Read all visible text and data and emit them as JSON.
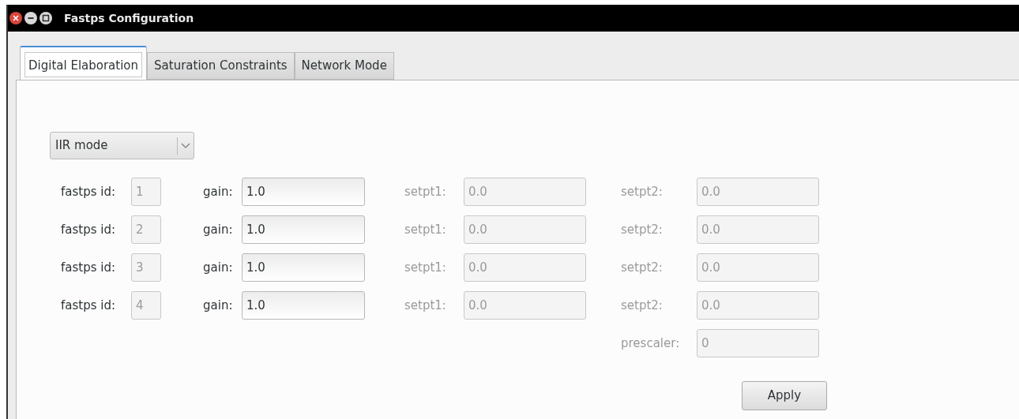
{
  "window": {
    "title": "Fastps Configuration"
  },
  "tabs": [
    {
      "label": "Digital Elaboration",
      "selected": true
    },
    {
      "label": "Saturation Constraints",
      "selected": false
    },
    {
      "label": "Network Mode",
      "selected": false
    }
  ],
  "mode_select": {
    "value": "IIR mode"
  },
  "rows": [
    {
      "id": {
        "label": "fastps id:",
        "label_disabled": false,
        "value": "1",
        "disabled": true
      },
      "gain": {
        "label": "gain:",
        "label_disabled": false,
        "value": "1.0",
        "disabled": false
      },
      "setpt1": {
        "label": "setpt1:",
        "label_disabled": true,
        "value": "0.0",
        "disabled": true
      },
      "setpt2": {
        "label": "setpt2:",
        "label_disabled": true,
        "value": "0.0",
        "disabled": true
      }
    },
    {
      "id": {
        "label": "fastps id:",
        "label_disabled": false,
        "value": "2",
        "disabled": true
      },
      "gain": {
        "label": "gain:",
        "label_disabled": false,
        "value": "1.0",
        "disabled": false
      },
      "setpt1": {
        "label": "setpt1:",
        "label_disabled": true,
        "value": "0.0",
        "disabled": true
      },
      "setpt2": {
        "label": "setpt2:",
        "label_disabled": true,
        "value": "0.0",
        "disabled": true
      }
    },
    {
      "id": {
        "label": "fastps id:",
        "label_disabled": false,
        "value": "3",
        "disabled": true
      },
      "gain": {
        "label": "gain:",
        "label_disabled": false,
        "value": "1.0",
        "disabled": false
      },
      "setpt1": {
        "label": "setpt1:",
        "label_disabled": true,
        "value": "0.0",
        "disabled": true
      },
      "setpt2": {
        "label": "setpt2:",
        "label_disabled": true,
        "value": "0.0",
        "disabled": true
      }
    },
    {
      "id": {
        "label": "fastps id:",
        "label_disabled": false,
        "value": "4",
        "disabled": true
      },
      "gain": {
        "label": "gain:",
        "label_disabled": false,
        "value": "1.0",
        "disabled": false
      },
      "setpt1": {
        "label": "setpt1:",
        "label_disabled": true,
        "value": "0.0",
        "disabled": true
      },
      "setpt2": {
        "label": "setpt2:",
        "label_disabled": true,
        "value": "0.0",
        "disabled": true
      }
    }
  ],
  "prescaler": {
    "label": "prescaler:",
    "label_disabled": true,
    "value": "0",
    "disabled": true
  },
  "apply_button": {
    "label": "Apply"
  }
}
